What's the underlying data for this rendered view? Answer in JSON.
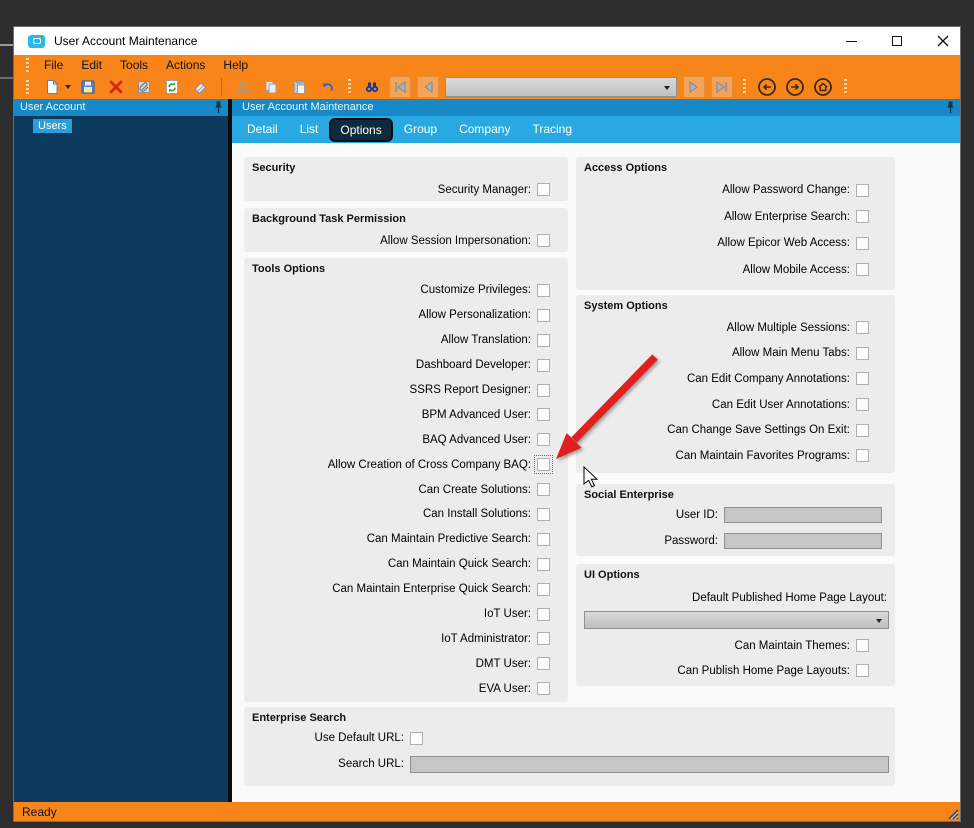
{
  "window": {
    "title": "User Account Maintenance",
    "controls": [
      "minimize",
      "maximize",
      "close"
    ]
  },
  "menu": {
    "items": [
      "File",
      "Edit",
      "Tools",
      "Actions",
      "Help"
    ]
  },
  "toolbar": {
    "icons": [
      "new",
      "new-dropdown",
      "save",
      "delete",
      "attachments",
      "refresh",
      "clear",
      "cut",
      "copy",
      "paste",
      "undo",
      "search",
      "first-record",
      "previous-record",
      "record-navigator",
      "next-record",
      "last-record",
      "back",
      "forward",
      "home"
    ],
    "record_navigator_value": ""
  },
  "tree_panel": {
    "header": "User Account",
    "items": [
      {
        "label": "Users",
        "selected": true
      }
    ]
  },
  "main_panel": {
    "header": "User Account Maintenance",
    "tabs": [
      {
        "label": "Detail",
        "selected": false
      },
      {
        "label": "List",
        "selected": false
      },
      {
        "label": "Options",
        "selected": true
      },
      {
        "label": "Group",
        "selected": false
      },
      {
        "label": "Company",
        "selected": false
      },
      {
        "label": "Tracing",
        "selected": false
      }
    ]
  },
  "sections": {
    "security": {
      "title": "Security",
      "rows": [
        {
          "label": "Security Manager:",
          "checked": false
        }
      ]
    },
    "background_task_permission": {
      "title": "Background Task Permission",
      "rows": [
        {
          "label": "Allow Session Impersonation:",
          "checked": false
        }
      ]
    },
    "tools_options": {
      "title": "Tools Options",
      "rows": [
        {
          "label": "Customize Privileges:",
          "checked": false
        },
        {
          "label": "Allow Personalization:",
          "checked": false
        },
        {
          "label": "Allow Translation:",
          "checked": false
        },
        {
          "label": "Dashboard Developer:",
          "checked": false
        },
        {
          "label": "SSRS Report Designer:",
          "checked": false
        },
        {
          "label": "BPM Advanced User:",
          "checked": false
        },
        {
          "label": "BAQ Advanced User:",
          "checked": false
        },
        {
          "label": "Allow Creation of Cross Company BAQ:",
          "checked": false,
          "focused": true
        },
        {
          "label": "Can Create Solutions:",
          "checked": false
        },
        {
          "label": "Can Install Solutions:",
          "checked": false
        },
        {
          "label": "Can Maintain Predictive Search:",
          "checked": false
        },
        {
          "label": "Can Maintain Quick Search:",
          "checked": false
        },
        {
          "label": "Can Maintain Enterprise Quick Search:",
          "checked": false
        },
        {
          "label": "IoT User:",
          "checked": false
        },
        {
          "label": "IoT Administrator:",
          "checked": false
        },
        {
          "label": "DMT User:",
          "checked": false
        },
        {
          "label": "EVA User:",
          "checked": false
        }
      ]
    },
    "access_options": {
      "title": "Access Options",
      "rows": [
        {
          "label": "Allow Password Change:",
          "checked": false
        },
        {
          "label": "Allow Enterprise Search:",
          "checked": false
        },
        {
          "label": "Allow Epicor Web Access:",
          "checked": false
        },
        {
          "label": "Allow Mobile Access:",
          "checked": false
        }
      ]
    },
    "system_options": {
      "title": "System Options",
      "rows": [
        {
          "label": "Allow Multiple Sessions:",
          "checked": false
        },
        {
          "label": "Allow Main Menu Tabs:",
          "checked": false
        },
        {
          "label": "Can Edit Company Annotations:",
          "checked": false
        },
        {
          "label": "Can Edit User Annotations:",
          "checked": false
        },
        {
          "label": "Can Change Save Settings On Exit:",
          "checked": false
        },
        {
          "label": "Can Maintain Favorites Programs:",
          "checked": false
        }
      ]
    },
    "social_enterprise": {
      "title": "Social Enterprise",
      "fields": [
        {
          "label": "User ID:",
          "value": "",
          "disabled": true
        },
        {
          "label": "Password:",
          "value": "",
          "disabled": true
        }
      ]
    },
    "ui_options": {
      "title": "UI Options",
      "layout_label": "Default Published Home Page Layout:",
      "layout_value": "",
      "rows": [
        {
          "label": "Can Maintain Themes:",
          "checked": false
        },
        {
          "label": "Can Publish Home Page Layouts:",
          "checked": false
        }
      ]
    },
    "enterprise_search": {
      "title": "Enterprise Search",
      "rows": [
        {
          "label": "Use Default URL:",
          "checked": false
        }
      ],
      "search_url_label": "Search URL:",
      "search_url_value": ""
    }
  },
  "status_bar": {
    "text": "Ready"
  },
  "annotation": {
    "type": "red-arrow",
    "points_to": "Allow Creation of Cross Company BAQ checkbox"
  },
  "colors": {
    "accent_orange": "#F8851A",
    "header_blue": "#1789C6",
    "tabstrip_blue": "#29A9E1",
    "panel_navy": "#0C3A5C",
    "selection_blue": "#2E9CD8",
    "selected_tab_navy": "#0F2A3C",
    "arrow_red": "#E02020",
    "desktop_background": "#2D2D2D"
  }
}
